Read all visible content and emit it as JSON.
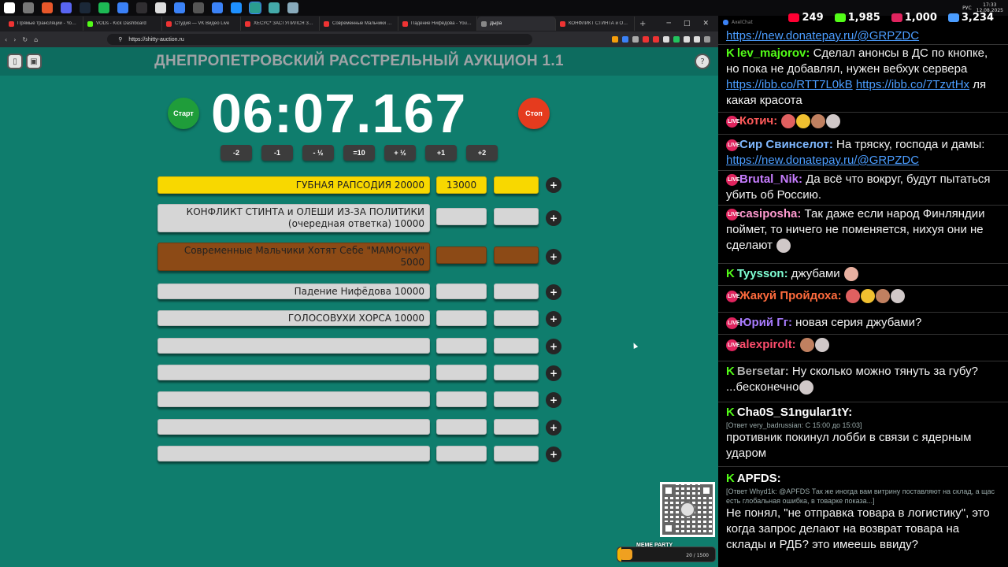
{
  "taskbar": {
    "icons": [
      "win-icon",
      "search-icon",
      "brave-icon",
      "discord-icon",
      "steam-icon",
      "spotify-icon",
      "chrome-icon",
      "obs-icon",
      "app-x-icon",
      "app-b-icon",
      "app-c-icon",
      "app-d-icon",
      "app-e-icon",
      "app-f-icon",
      "app-g-icon",
      "app-h-icon"
    ],
    "lang": "РУС",
    "time": "17:33",
    "date": "12.08.2025"
  },
  "browser": {
    "tabs": [
      {
        "label": "Прямые трансляции - YouTube",
        "color": "#e33"
      },
      {
        "label": "VODs - Kick Dashboard",
        "color": "#53fc18"
      },
      {
        "label": "Студия — VK Видео Live",
        "color": "#e33"
      },
      {
        "label": "ХЕСУС* ЗАСТУПИЛСЯ ЗА КАР",
        "color": "#e33"
      },
      {
        "label": "Современные Мальчики Хотя",
        "color": "#e33"
      },
      {
        "label": "Падение Нифёдова - YouTube",
        "color": "#e33"
      },
      {
        "label": "Дыра",
        "color": "#888",
        "active": true
      },
      {
        "label": "КОНФЛИКТ СТИНТА и ОЛЕШИ",
        "color": "#e33"
      }
    ],
    "url": "https://shitty-auction.ru"
  },
  "app": {
    "title": "ДНЕПРОПЕТРОВСКИЙ РАССТРЕЛЬНЫЙ АУКЦИОН 1.1",
    "timer": "06:07.167",
    "start_label": "Старт",
    "stop_label": "Стоп",
    "adjust_buttons": [
      "-2",
      "-1",
      "- ½",
      "=10",
      "+ ½",
      "+1",
      "+2"
    ],
    "lots": [
      {
        "name": "ГУБНАЯ РАПСОДИЯ 20000",
        "value": "13000",
        "style": "yellow"
      },
      {
        "name": "КОНФЛИКТ СТИНТА и ОЛЕШИ ИЗ-ЗА ПОЛИТИКИ (очередная ответка) 10000",
        "value": "",
        "style": "grey"
      },
      {
        "name": "Современные Мальчики Хотят Себе \"МАМОЧКУ\" 5000",
        "value": "",
        "style": "brown"
      },
      {
        "name": "Падение Нифёдова 10000",
        "value": "",
        "style": "grey"
      },
      {
        "name": "ГОЛОСОВУХИ ХОРСА 10000",
        "value": "",
        "style": "grey"
      },
      {
        "name": "",
        "value": "",
        "style": "grey"
      },
      {
        "name": "",
        "value": "",
        "style": "grey"
      },
      {
        "name": "",
        "value": "",
        "style": "grey"
      },
      {
        "name": "",
        "value": "",
        "style": "grey"
      },
      {
        "name": "",
        "value": "",
        "style": "grey"
      }
    ],
    "plus_label": "+",
    "goal": {
      "title": "MEME PARTY",
      "progress_text": "20 / 1500",
      "progress": 0.013
    }
  },
  "chat": {
    "app_name": "AxelChat",
    "viewers": [
      {
        "platform": "youtube",
        "count": "249",
        "color": "#ff0033"
      },
      {
        "platform": "kick",
        "count": "1,985",
        "color": "#53fc18"
      },
      {
        "platform": "vk",
        "count": "1,000",
        "color": "#e0245e"
      },
      {
        "platform": "total",
        "count": "3,234",
        "color": "#4b9dff"
      }
    ],
    "messages": [
      {
        "platform": "",
        "user": "",
        "text": "",
        "link": "https://new.donatepay.ru/@GRPZDC",
        "user_color": "#fff"
      },
      {
        "platform": "kick",
        "user": "lev_majorov:",
        "text": "Сделал анонсы в ДС по кнопке, но пока не добавлял, нужен вебхук сервера",
        "link": "https://ibb.co/RTT7L0kB",
        "link2": "https://ibb.co/7TzvtHx",
        "tail": "ля какая красота",
        "user_color": "#53fc18"
      },
      {
        "platform": "vk",
        "user": "Котич:",
        "text": "",
        "user_color": "#ff5a5a"
      },
      {
        "platform": "vk",
        "user": "Сир Свинселот:",
        "text": "На тряску, господа и дамы:",
        "link": "https://new.donatepay.ru/@GRPZDC",
        "user_color": "#7fb8ff"
      },
      {
        "platform": "vk",
        "user": "Brutal_Nik:",
        "text": "Да всё что вокруг, будут пытаться убить об Россию.",
        "user_color": "#c77dff"
      },
      {
        "platform": "vk",
        "user": "casiposha:",
        "text": "Так даже если народ Финляндии поймет, то ничего не поменяется, нихуя они не сделают",
        "user_color": "#ff9ad0"
      },
      {
        "platform": "kick",
        "user": "Tyysson:",
        "text": "джубами",
        "user_color": "#7fffd4"
      },
      {
        "platform": "vk",
        "user": "Жакуй Пройдоха:",
        "text": "",
        "user_color": "#ff6b3d"
      },
      {
        "platform": "vk",
        "user": "Юрий Гг:",
        "text": "новая серия джубами?",
        "user_color": "#a97cff"
      },
      {
        "platform": "vk",
        "user": "alexpirolt:",
        "text": "",
        "user_color": "#ff4d6d"
      },
      {
        "platform": "kick",
        "user": "Bersetar:",
        "text": "Ну сколько можно тянуть за губу?",
        "text2": "...бесконечно",
        "user_color": "#b0b0b0"
      },
      {
        "platform": "kick",
        "user": "Cha0S_S1ngular1tY:",
        "reply": "[Ответ very_badrussian: С 15:00 до 15:03]",
        "text": "противник покинул лобби в связи с ядерным ударом",
        "user_color": "#fff"
      },
      {
        "platform": "kick",
        "user": "APFDS:",
        "reply": "[Ответ Whyd1k: @APFDS Так же иногда вам витрину поставляют на склад, а щас есть глобальная ошибка, в товарке показа...]",
        "text": "Не понял, \"не отправка товара в логистику\", это когда запрос делают на возврат товара на склады и РДБ? это имеешь ввиду?",
        "user_color": "#fff"
      }
    ]
  }
}
